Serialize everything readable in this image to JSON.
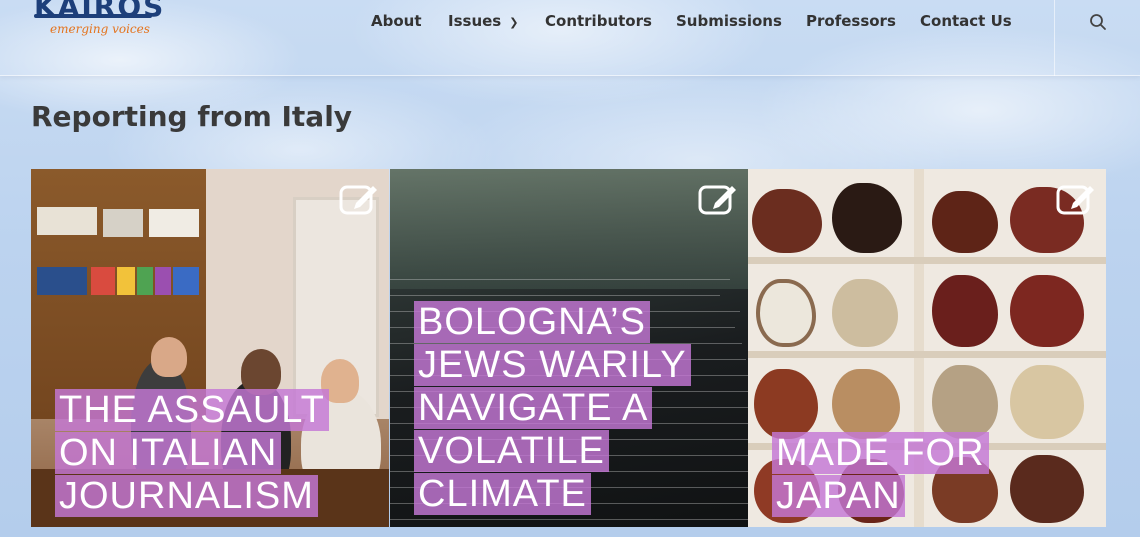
{
  "brand": {
    "name": "KAIROS",
    "tagline": "emerging voices",
    "primary_color": "#1d3f7a",
    "accent_color": "#e4731c"
  },
  "nav": {
    "items": [
      {
        "label": "About"
      },
      {
        "label": "Issues",
        "has_dropdown": true
      },
      {
        "label": "Contributors"
      },
      {
        "label": "Submissions"
      },
      {
        "label": "Professors"
      },
      {
        "label": "Contact Us"
      }
    ],
    "search_icon": "search-icon"
  },
  "page": {
    "title": "Reporting from Italy"
  },
  "cards": [
    {
      "title": "THE ASSAULT ON ITALIAN JOURNALISM",
      "icon": "edit-icon",
      "title_bg": "#c478d6"
    },
    {
      "title": "BOLOGNA’S JEWS WARILY NAVIGATE A VOLATILE CLIMATE",
      "icon": "edit-icon",
      "title_bg": "#c478d6"
    },
    {
      "title": "MADE FOR JAPAN",
      "icon": "edit-icon",
      "title_bg": "#c478d6"
    }
  ]
}
